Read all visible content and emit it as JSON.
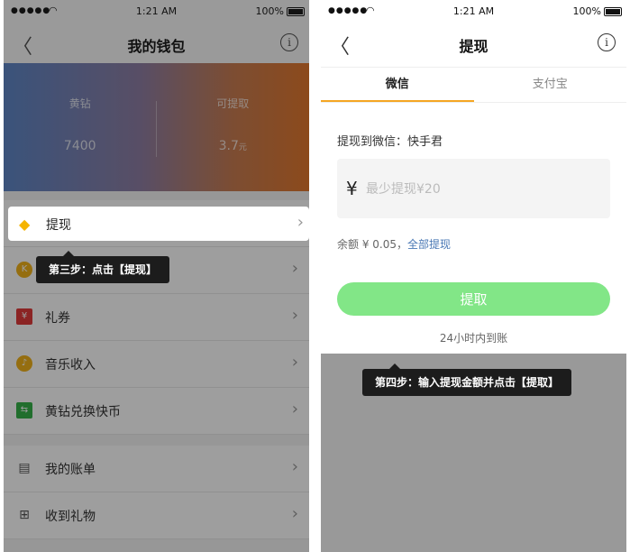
{
  "status_bar": {
    "signal": "●●●●●",
    "time": "1:21 AM",
    "battery": "100%"
  },
  "left_screen": {
    "title": "我的钱包",
    "stats": [
      {
        "label": "黄钻",
        "value": "7400",
        "unit": ""
      },
      {
        "label": "可提取",
        "value": "3.7",
        "unit": "元"
      }
    ],
    "highlight_item": "提现",
    "menu_items": [
      {
        "label": "",
        "icon": "coin-icon",
        "icon_glyph": "K",
        "color": "#f1b21a"
      },
      {
        "label": "礼券",
        "icon": "ticket-icon",
        "icon_glyph": "¥",
        "color": "#e03b3b"
      },
      {
        "label": "音乐收入",
        "icon": "music-note-icon",
        "icon_glyph": "♪",
        "color": "#f1b21a"
      },
      {
        "label": "黄钻兑换快币",
        "icon": "exchange-icon",
        "icon_glyph": "⇆",
        "color": "#36b24a"
      }
    ],
    "menu_items_2": [
      {
        "label": "我的账单",
        "icon": "calendar-icon",
        "icon_glyph": "▤"
      },
      {
        "label": "收到礼物",
        "icon": "gift-icon",
        "icon_glyph": "⊞"
      }
    ],
    "tooltip": "第三步：点击【提现】"
  },
  "right_screen": {
    "title": "提现",
    "tabs": [
      {
        "label": "微信"
      },
      {
        "label": "支付宝"
      }
    ],
    "withdraw_to": "提现到微信：快手君",
    "currency": "¥",
    "amount_placeholder": "最少提现¥20",
    "balance_text": "余额 ¥ 0.05，",
    "withdraw_all": "全部提现",
    "submit_label": "提取",
    "arrive_text": "24小时内到账",
    "tooltip": "第四步：输入提现金额并点击【提取】"
  }
}
